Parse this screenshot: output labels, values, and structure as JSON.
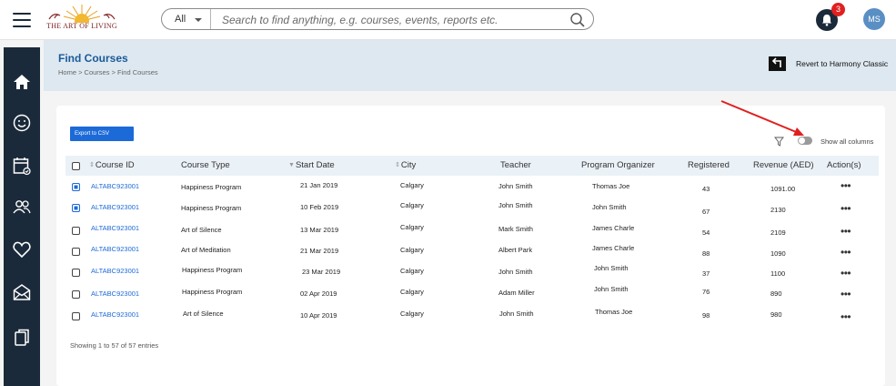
{
  "brand": {
    "logo_text": "THE ART OF LIVING"
  },
  "search": {
    "scope": "All",
    "placeholder": "Search to find anything, e.g. courses, events, reports etc."
  },
  "notifications": {
    "count": "3"
  },
  "user": {
    "initials": "MS"
  },
  "header": {
    "title": "Find Courses",
    "breadcrumb": "Home > Courses > Find Courses",
    "revert_label": "Revert to Harmony Classic"
  },
  "toolbar": {
    "export_label": "Export to CSV",
    "show_columns_label": "Show all columns"
  },
  "table": {
    "columns": [
      "Course  ID",
      "Course Type",
      "Start  Date",
      "City",
      "Teacher",
      "Program Organizer",
      "Registered",
      "Revenue (AED)",
      "Action(s)"
    ],
    "rows": [
      {
        "checked": true,
        "id": "ALTABC923001",
        "type": "Happiness Program",
        "date": "21 Jan 2019",
        "city": "Calgary",
        "teacher": "John Smith",
        "organizer": "Thomas Joe",
        "registered": "43",
        "revenue": "1091.00"
      },
      {
        "checked": true,
        "id": "ALTABC923001",
        "type": "Happiness Program",
        "date": "10 Feb 2019",
        "city": "Calgary",
        "teacher": "John Smith",
        "organizer": "John Smith",
        "registered": "67",
        "revenue": "2130"
      },
      {
        "checked": false,
        "id": "ALTABC923001",
        "type": "Art of Silence",
        "date": "13 Mar  2019",
        "city": "Calgary",
        "teacher": "Mark Smith",
        "organizer": "James Charle",
        "registered": "54",
        "revenue": "2109"
      },
      {
        "checked": false,
        "id": "ALTABC923001",
        "type": "Art of Meditation",
        "date": "21 Mar  2019",
        "city": "Calgary",
        "teacher": "Albert Park",
        "organizer": "James Charle",
        "registered": "88",
        "revenue": "1090"
      },
      {
        "checked": false,
        "id": "ALTABC923001",
        "type": "Happiness Program",
        "date": "23  Mar  2019",
        "city": "Calgary",
        "teacher": "John Smith",
        "organizer": "John Smith",
        "registered": "37",
        "revenue": "1100"
      },
      {
        "checked": false,
        "id": "ALTABC923001",
        "type": "Happiness Program",
        "date": "02 Apr 2019",
        "city": "Calgary",
        "teacher": "Adam Miller",
        "organizer": "John Smith",
        "registered": "76",
        "revenue": "890"
      },
      {
        "checked": false,
        "id": "ALTABC923001",
        "type": "Art of Silence",
        "date": "10 Apr 2019",
        "city": "Calgary",
        "teacher": "John Smith",
        "organizer": "Thomas Joe",
        "registered": "98",
        "revenue": "980"
      }
    ],
    "action_glyph": "•••",
    "footer": "Showing 1 to 57 of 57 entries"
  },
  "colors": {
    "sidebar": "#1b2a3a",
    "accent": "#1c6ad8",
    "header_band": "#dde8f0",
    "annotation_arrow": "#e02020"
  }
}
